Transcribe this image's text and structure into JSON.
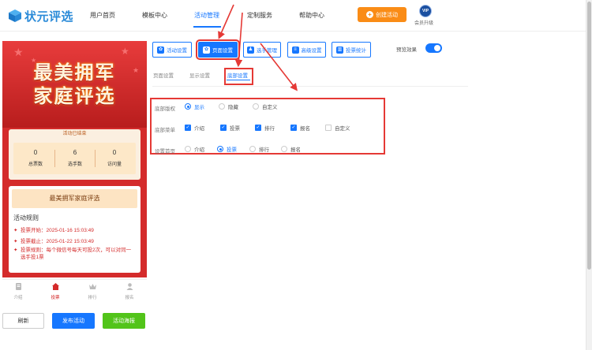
{
  "app": {
    "logo_text": "状元评选"
  },
  "header": {
    "nav": [
      {
        "label": "用户首页"
      },
      {
        "label": "模板中心"
      },
      {
        "label": "活动管理"
      },
      {
        "label": "定制服务"
      },
      {
        "label": "帮助中心"
      }
    ],
    "create_button": "创建活动",
    "vip_badge": "VIP",
    "vip_label": "会员升级"
  },
  "preview": {
    "banner_line1": "最美拥军",
    "banner_line2": "家庭评选",
    "status": "活动已结束",
    "stats": [
      {
        "value": "0",
        "label": "总票数"
      },
      {
        "value": "6",
        "label": "选手数"
      },
      {
        "value": "0",
        "label": "访问量"
      }
    ],
    "card_title": "最美拥军家庭评选",
    "rules_title": "活动规则",
    "rules": [
      "投票开始：2025-01-16 15:03:49",
      "投票截止：2025-01-22 15:03:49",
      "投票规则：每个微信号每天可投2次，可以对同一选手投1票"
    ],
    "tabs": [
      {
        "label": "介绍"
      },
      {
        "label": "投票"
      },
      {
        "label": "排行"
      },
      {
        "label": "报名"
      }
    ]
  },
  "actions": {
    "refresh": "刷新",
    "publish": "发布活动",
    "poster": "活动海报"
  },
  "toolbar": {
    "tools": [
      {
        "label": "活动设置"
      },
      {
        "label": "页面设置"
      },
      {
        "label": "选手管理"
      },
      {
        "label": "高级设置"
      },
      {
        "label": "投票统计"
      }
    ],
    "preview_label": "预览效果"
  },
  "subtabs": [
    {
      "label": "页面设置"
    },
    {
      "label": "显示设置"
    },
    {
      "label": "底部设置"
    }
  ],
  "settings": {
    "copyright": {
      "label": "底部版权",
      "options": [
        "显示",
        "隐藏",
        "自定义"
      ],
      "selected": "显示"
    },
    "menu": {
      "label": "底部菜单",
      "options": [
        "介绍",
        "投票",
        "排行",
        "报名",
        "自定义"
      ],
      "checked": [
        "介绍",
        "投票",
        "排行",
        "报名"
      ]
    },
    "homepage": {
      "label": "设置首页",
      "options": [
        "介绍",
        "投票",
        "排行",
        "报名"
      ],
      "selected": "投票"
    }
  },
  "colors": {
    "primary": "#1677ff",
    "orange": "#fa8c16",
    "green": "#52c41a",
    "poster_red": "#d42b2b",
    "annotation_red": "#e53935"
  }
}
